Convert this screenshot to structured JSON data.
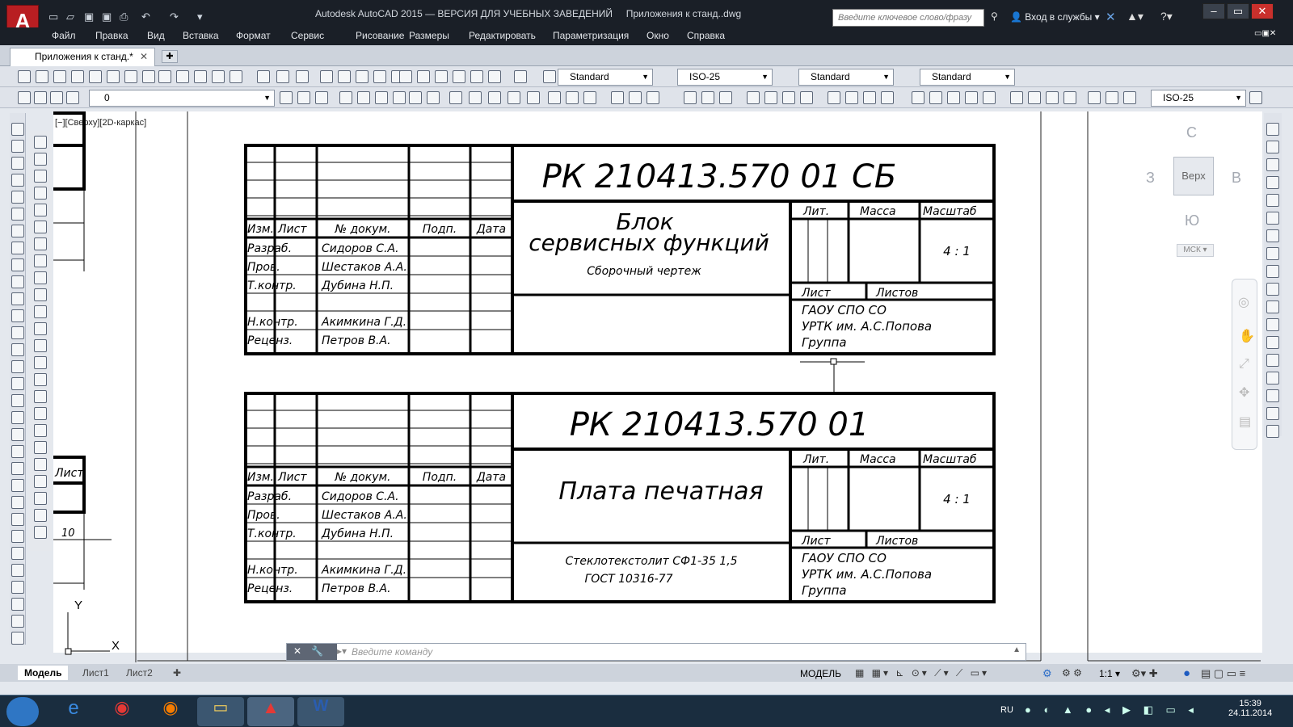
{
  "titlebar": {
    "app_title": "Autodesk AutoCAD 2015 — ВЕРСИЯ ДЛЯ УЧЕБНЫХ ЗАВЕДЕНИЙ",
    "doc_title": "Приложения к станд..dwg",
    "search_placeholder": "Введите ключевое слово/фразу",
    "login": "Вход в службы"
  },
  "menu": [
    "Файл",
    "Правка",
    "Вид",
    "Вставка",
    "Формат",
    "Сервис",
    "Рисование",
    "Размеры",
    "Редактировать",
    "Параметризация",
    "Окно",
    "Справка"
  ],
  "doc_tab": "Приложения к станд.*",
  "toolbar": {
    "text_style": "Standard",
    "dim_style": "ISO-25",
    "table_style": "Standard",
    "mleader_style": "Standard",
    "layer": "0",
    "dim_style_2": "ISO-25"
  },
  "viewport_label": "[−][Сверху][2D-каркас]",
  "viewcube": {
    "top": "Верх",
    "n": "С",
    "s": "Ю",
    "w": "З",
    "e": "В",
    "ucs": "МСК"
  },
  "ucs": {
    "x": "X",
    "y": "Y"
  },
  "left_fragment": {
    "list": "Лист",
    "dim": "10"
  },
  "block1": {
    "code": "РК 210413.570 01 СБ",
    "name1": "Блок",
    "name2": "сервисных функций",
    "subtitle": "Сборочный чертеж",
    "scale": "4 : 1"
  },
  "block2": {
    "code": "РК 210413.570 01",
    "name": "Плата печатная",
    "mat1": "Стеклотекстолит СФ1-35 1,5",
    "mat2": "ГОСТ 10316-77",
    "scale": "4 : 1"
  },
  "common": {
    "h_izm": "Изм.",
    "h_list": "Лист",
    "h_doc": "№ докум.",
    "h_podp": "Подп.",
    "h_data": "Дата",
    "lit": "Лит.",
    "massa": "Масса",
    "masshtab": "Масштаб",
    "list": "Лист",
    "listov": "Листов",
    "org1": "ГАОУ СПО СО",
    "org2": "УРТК им. А.С.Попова",
    "org3": "Группа",
    "rows": [
      [
        "Разраб.",
        "Сидоров С.А."
      ],
      [
        "Пров.",
        "Шестаков А.А."
      ],
      [
        "Т.контр.",
        "Дубина Н.П."
      ],
      [
        "",
        ""
      ],
      [
        "Н.контр.",
        "Акимкина Г.Д."
      ],
      [
        "Реценз.",
        "Петров В.А."
      ]
    ]
  },
  "command": {
    "placeholder": "Введите команду"
  },
  "layout_tabs": [
    "Модель",
    "Лист1",
    "Лист2"
  ],
  "status": {
    "mode": "МОДЕЛЬ",
    "scale": "1:1"
  },
  "taskbar": {
    "lang": "RU",
    "time": "15:39",
    "date": "24.11.2014"
  }
}
